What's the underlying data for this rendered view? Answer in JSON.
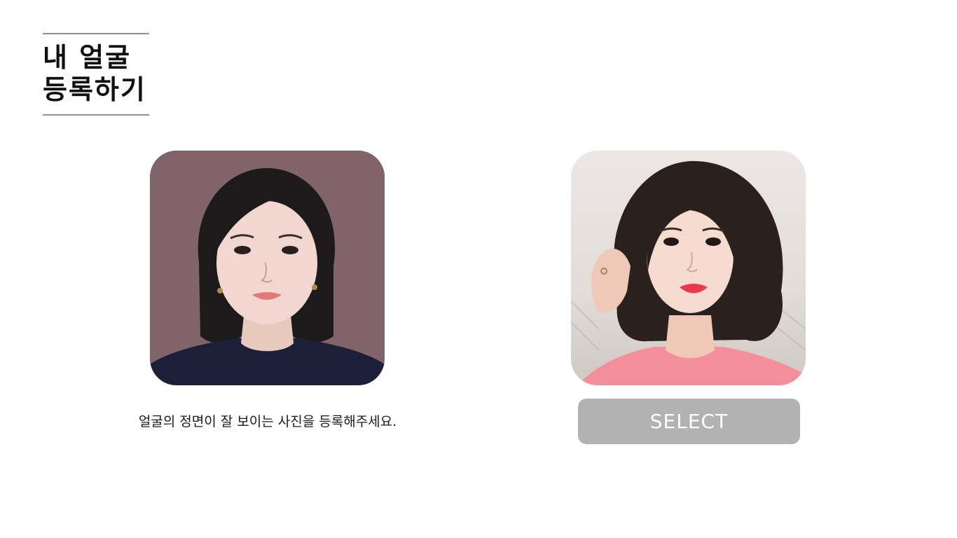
{
  "title": {
    "line1": "내 얼굴",
    "line2": "등록하기"
  },
  "example_photo": {
    "alt": "example-front-face-photo"
  },
  "user_photo": {
    "alt": "selected-face-photo"
  },
  "caption": "얼굴의 정면이 잘 보이는 사진을 등록해주세요.",
  "select_button": {
    "label": "SELECT"
  },
  "colors": {
    "title_rule": "#9a8f88",
    "button_bg": "#b2b2b2",
    "button_text": "#ffffff",
    "example_bg": "#806469"
  }
}
